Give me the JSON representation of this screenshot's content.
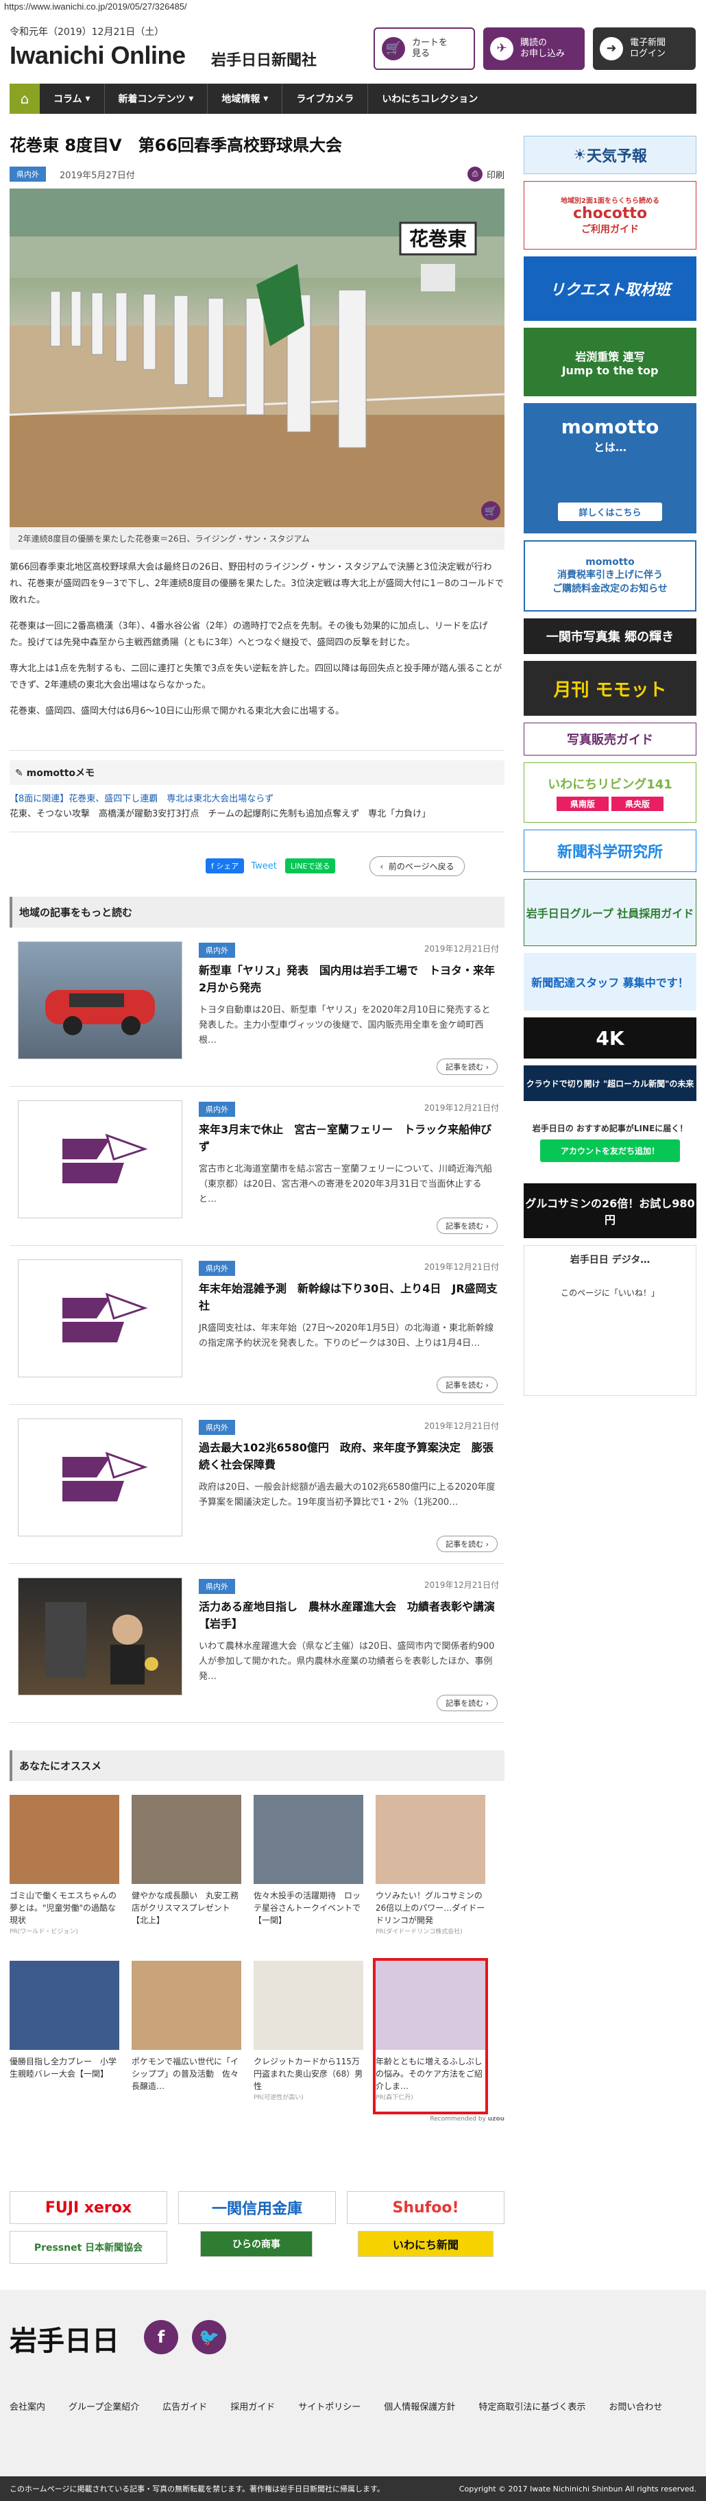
{
  "url": "https://www.iwanichi.co.jp/2019/05/27/326485/",
  "header": {
    "date": "令和元年（2019）12月21日（土）",
    "brand": "Iwanichi Online",
    "brand_sub": "岩手日日新聞社",
    "cart_label": "カートを\n見る",
    "subscribe_label": "購読の\nお申し込み",
    "login_label": "電子新聞\nログイン"
  },
  "nav": [
    "コラム",
    "新着コンテンツ",
    "地域情報",
    "ライブカメラ",
    "いわにちコレクション"
  ],
  "article": {
    "title": "花巻東 8度目V　第66回春季高校野球県大会",
    "tag": "県内外",
    "date": "2019年5月27日付",
    "print": "印刷",
    "photo_sign": "花巻東",
    "caption": "2年連続8度目の優勝を果たした花巻東＝26日、ライジング・サン・スタジアム",
    "paragraphs": [
      "第66回春季東北地区高校野球県大会は最終日の26日、野田村のライジング・サン・スタジアムで決勝と3位決定戦が行われ、花巻東が盛岡四を9－3で下し、2年連続8度目の優勝を果たした。3位決定戦は専大北上が盛岡大付に1－8のコールドで敗れた。",
      "花巻東は一回に2番高橋漢（3年）、4番水谷公省（2年）の適時打で2点を先制。その後も効果的に加点し、リードを広げた。投げては先発中森至から主戦西舘勇陽（ともに3年）へとつなぐ継投で、盛岡四の反撃を封じた。",
      "専大北上は1点を先制するも、二回に連打と失策で3点を失い逆転を許した。四回以降は毎回失点と投手陣が踏ん張ることができず、2年連続の東北大会出場はならなかった。",
      "花巻東、盛岡四、盛岡大付は6月6～10日に山形県で開かれる東北大会に出場する。"
    ]
  },
  "memo": {
    "heading": "momottoメモ",
    "link": "【8面に関連】花巻東、盛四下し連覇　専北は東北大会出場ならず",
    "text": "花東、そつない攻撃　高橋漢が躍動3安打3打点　チームの起爆剤に先制も追加点奪えず　専北「力負け」"
  },
  "share": {
    "facebook": "f シェア",
    "tweet": "Tweet",
    "line": "LINEで送る",
    "back": "前のページへ戻る"
  },
  "more_section": {
    "heading": "地域の記事をもっと読む",
    "more_label": "記事を読む",
    "items": [
      {
        "tag": "県内外",
        "date": "2019年12月21日付",
        "title": "新型車「ヤリス」発表　国内用は岩手工場で　トヨタ・来年2月から発売",
        "body": "トヨタ自動車は20日、新型車「ヤリス」を2020年2月10日に発売すると発表した。主力小型車ヴィッツの後継で、国内販売用全車を金ケ崎町西根…"
      },
      {
        "tag": "県内外",
        "date": "2019年12月21日付",
        "title": "来年3月末で休止　宮古－室蘭フェリー　トラック来船伸びず",
        "body": "宮古市と北海道室蘭市を結ぶ宮古－室蘭フェリーについて、川崎近海汽船（東京都）は20日、宮古港への寄港を2020年3月31日で当面休止すると…"
      },
      {
        "tag": "県内外",
        "date": "2019年12月21日付",
        "title": "年末年始混雑予測　新幹線は下り30日、上り4日　JR盛岡支社",
        "body": "JR盛岡支社は、年末年始（27日～2020年1月5日）の北海道・東北新幹線の指定席予約状況を発表した。下りのピークは30日、上りは1月4日…"
      },
      {
        "tag": "県内外",
        "date": "2019年12月21日付",
        "title": "過去最大102兆6580億円　政府、来年度予算案決定　膨張続く社会保障費",
        "body": "政府は20日、一般会計総額が過去最大の102兆6580億円に上る2020年度予算案を閣議決定した。19年度当初予算比で1・2％（1兆200…"
      },
      {
        "tag": "県内外",
        "date": "2019年12月21日付",
        "title": "活力ある産地目指し　農林水産躍進大会　功績者表彰や講演【岩手】",
        "body": "いわて農林水産躍進大会（県など主催）は20日、盛岡市内で関係者約900人が参加して開かれた。県内農林水産業の功績者らを表彰したほか、事例発…"
      }
    ]
  },
  "recommend": {
    "heading": "あなたにオススメ",
    "footer": "Recommended by",
    "items": [
      {
        "title": "ゴミ山で働くモエスちゃんの夢とは。\"児童労働\"の過酷な現状",
        "source": "PR(ワールド・ビジョン)"
      },
      {
        "title": "健やかな成長願い　丸安工務店がクリスマスプレゼント【北上】",
        "source": ""
      },
      {
        "title": "佐々木投手の活躍期待　ロッテ星谷さんトークイベントで【一関】",
        "source": ""
      },
      {
        "title": "ウソみたい！グルコサミンの26倍以上のパワー…ダイドードリンコが開発",
        "source": "PR(ダイドードリンコ株式会社)"
      },
      {
        "title": "優勝目指し全力プレー　小学生親睦バレー大会【一関】",
        "source": ""
      },
      {
        "title": "ポケモンで福広い世代に「イシッププ」の普及活動　佐々長醸造…",
        "source": ""
      },
      {
        "title": "クレジットカードから115万円盗まれた奥山安彦（68）男性",
        "source": "PR(可逆性が高い)"
      },
      {
        "title": "年齢とともに増えるふしぶしの悩み。そのケア方法をご紹介しま…",
        "source": "PR(森下仁丹)"
      }
    ]
  },
  "sidebar": {
    "weather": "天気予報",
    "chocotto_top": "地域別2面1面をらくちら読める",
    "chocotto_main": "chocotto",
    "chocotto_sub": "ご利用ガイド",
    "request": "リクエスト取材班",
    "iwasaki": "岩渕重策 連写\nJump to the top",
    "momotto_title": "momotto",
    "momotto_sub": "とは…",
    "momotto_btn": "詳しくはこちら",
    "momotto2": "momotto\n消費税率引き上げに伴う\nご購読料金改定のお知らせ",
    "furusato": "一関市写真集 郷の輝き",
    "monthly": "月刊 モモット",
    "digital_guide": "写真販売ガイド",
    "living": "いわにちリビング141",
    "living_tabs": [
      "県南版",
      "県央版"
    ],
    "research": "新聞科学研究所",
    "recruit": "岩手日日グループ 社員採用ガイド",
    "staff": "新聞配達スタッフ 募集中です！",
    "tv4k": "4K",
    "cloud": "クラウドで切り開け \"超ローカル新聞\"の未来",
    "line_text": "岩手日日の おすすめ記事がLINEに届く！",
    "line_btn": "アカウントを友だち追加！",
    "ad": "グルコサミンの26倍！お試し980円",
    "fb_name": "岩手日日 デジタ…",
    "fb_like": "このページに「いいね！」"
  },
  "footer": {
    "partners": [
      "FUJI xerox",
      "一関信用金庫",
      "Shufoo!",
      "Pressnet 日本新聞協会",
      "ひらの商事",
      "いわにち新聞"
    ],
    "logo": "岩手日日",
    "links": [
      "会社案内",
      "グループ企業紹介",
      "広告ガイド",
      "採用ガイド",
      "サイトポリシー",
      "個人情報保護方針",
      "特定商取引法に基づく表示",
      "お問い合わせ"
    ],
    "notice": "このホームページに掲載されている記事・写真の無断転載を禁じます。著作権は岩手日日新聞社に帰属します。",
    "copyright": "Copyright © 2017 Iwate Nichinichi Shinbun All rights reserved."
  }
}
